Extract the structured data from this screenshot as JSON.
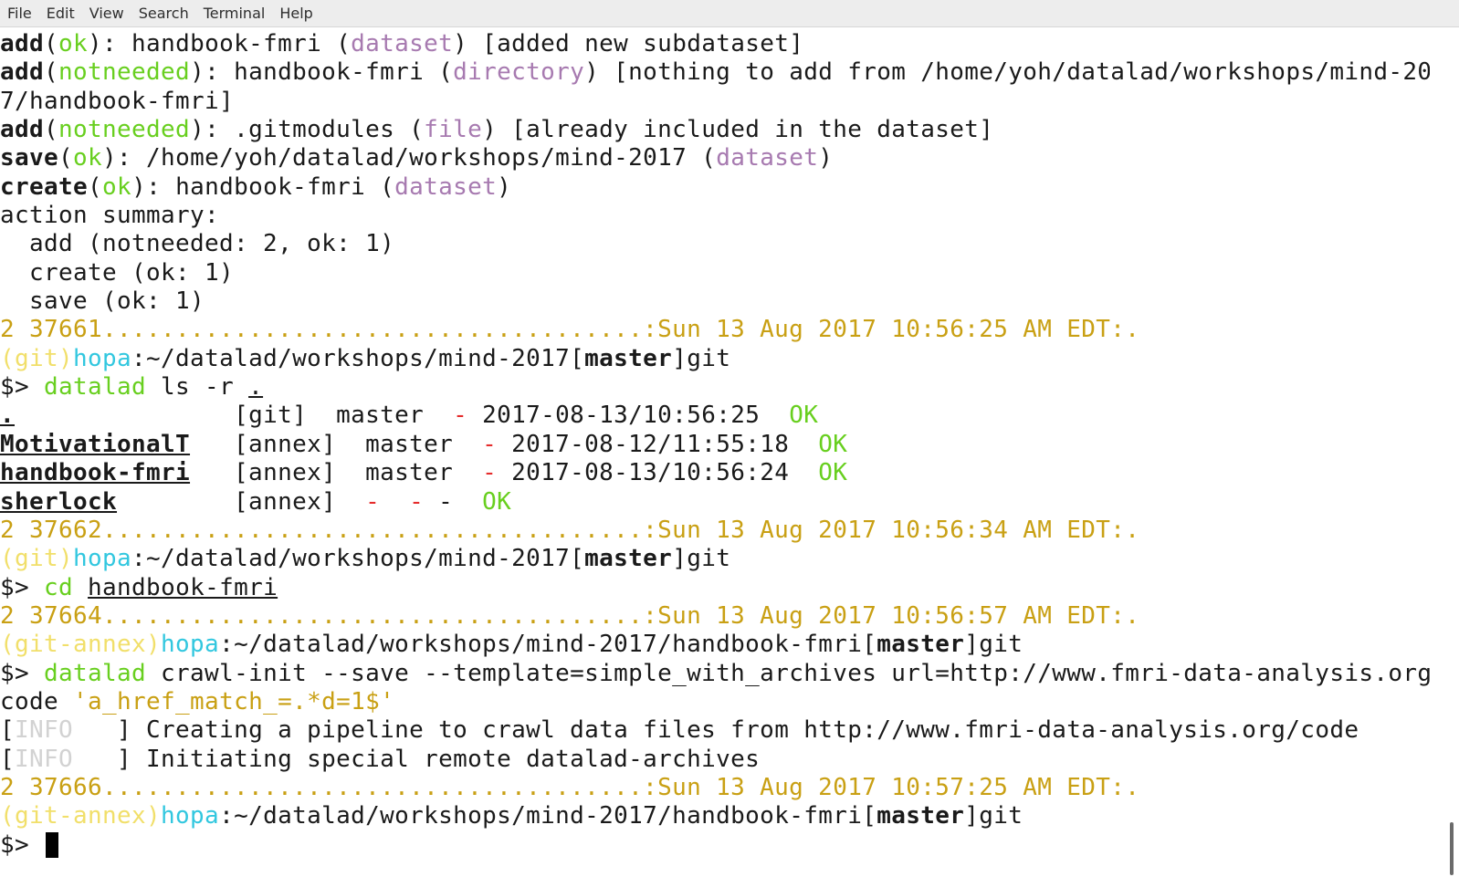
{
  "menu": {
    "file": "File",
    "edit": "Edit",
    "view": "View",
    "search": "Search",
    "terminal": "Terminal",
    "help": "Help"
  },
  "lines": {
    "l1": {
      "a": "add",
      "b": "(",
      "c": "ok",
      "d": "): handbook-fmri (",
      "e": "dataset",
      "f": ") [added new subdataset]"
    },
    "l2": {
      "a": "add",
      "b": "(",
      "c": "notneeded",
      "d": "): handbook-fmri (",
      "e": "directory",
      "f": ") [nothing to add from /home/yoh/datalad/workshops/mind-201"
    },
    "l3": {
      "a": "7/handbook-fmri]"
    },
    "l4": {
      "a": "add",
      "b": "(",
      "c": "notneeded",
      "d": "): .gitmodules (",
      "e": "file",
      "f": ") [already included in the dataset]"
    },
    "l5": {
      "a": "save",
      "b": "(",
      "c": "ok",
      "d": "): /home/yoh/datalad/workshops/mind-2017 (",
      "e": "dataset",
      "f": ")"
    },
    "l6": {
      "a": "create",
      "b": "(",
      "c": "ok",
      "d": "): handbook-fmri (",
      "e": "dataset",
      "f": ")"
    },
    "l7": {
      "a": "action summary:"
    },
    "l8": {
      "a": "  add (notneeded: 2, ok: 1)"
    },
    "l9": {
      "a": "  create (ok: 1)"
    },
    "l10": {
      "a": "  save (ok: 1)"
    },
    "l11": {
      "a": "2 37661.....................................:Sun 13 Aug 2017 10:56:25 AM EDT:."
    },
    "l12": {
      "a": "(git)",
      "b": "hopa",
      "c": ":~/datalad/workshops/mind-2017[",
      "d": "master",
      "e": "]git"
    },
    "l13": {
      "a": "$> ",
      "b": "datalad",
      "c": " ls -r ",
      "d": "."
    },
    "l14": {
      "a": ".",
      "b": "               [git]  master  ",
      "c": "-",
      "d": " 2017-08-13/10:56:25  ",
      "e": "OK"
    },
    "l15": {
      "a": "MotivationalT",
      "b": "   [annex]  master  ",
      "c": "-",
      "d": " 2017-08-12/11:55:18  ",
      "e": "OK"
    },
    "l16": {
      "a": "handbook-fmri",
      "b": "   [annex]  master  ",
      "c": "-",
      "d": " 2017-08-13/10:56:24  ",
      "e": "OK"
    },
    "l17": {
      "a": "sherlock",
      "b": "        [annex]  ",
      "c": "-",
      "d": "  ",
      "e": "-",
      "f": " -  ",
      "g": "OK"
    },
    "l18": {
      "a": "2 37662.....................................:Sun 13 Aug 2017 10:56:34 AM EDT:."
    },
    "l19": {
      "a": "(git)",
      "b": "hopa",
      "c": ":~/datalad/workshops/mind-2017[",
      "d": "master",
      "e": "]git"
    },
    "l20": {
      "a": "$> ",
      "b": "cd",
      "c": " ",
      "d": "handbook-fmri"
    },
    "l21": {
      "a": "2 37664.....................................:Sun 13 Aug 2017 10:56:57 AM EDT:."
    },
    "l22": {
      "a": "(git-annex)",
      "b": "hopa",
      "c": ":~/datalad/workshops/mind-2017/handbook-fmri[",
      "d": "master",
      "e": "]git"
    },
    "l23": {
      "a": "$> ",
      "b": "datalad",
      "c": " crawl-init --save --template=simple_with_archives url=http://www.fmri-data-analysis.org/"
    },
    "l24": {
      "a": "code ",
      "b": "'a_href_match_=.*d=1$'"
    },
    "l25": {
      "a": "[",
      "b": "INFO",
      "c": "   ] Creating a pipeline to crawl data files from http://www.fmri-data-analysis.org/code"
    },
    "l26": {
      "a": "[",
      "b": "INFO",
      "c": "   ] Initiating special remote datalad-archives"
    },
    "l27": {
      "a": "2 37666.....................................:Sun 13 Aug 2017 10:57:25 AM EDT:."
    },
    "l28": {
      "a": "(git-annex)",
      "b": "hopa",
      "c": ":~/datalad/workshops/mind-2017/handbook-fmri[",
      "d": "master",
      "e": "]git"
    },
    "l29": {
      "a": "$> "
    }
  }
}
